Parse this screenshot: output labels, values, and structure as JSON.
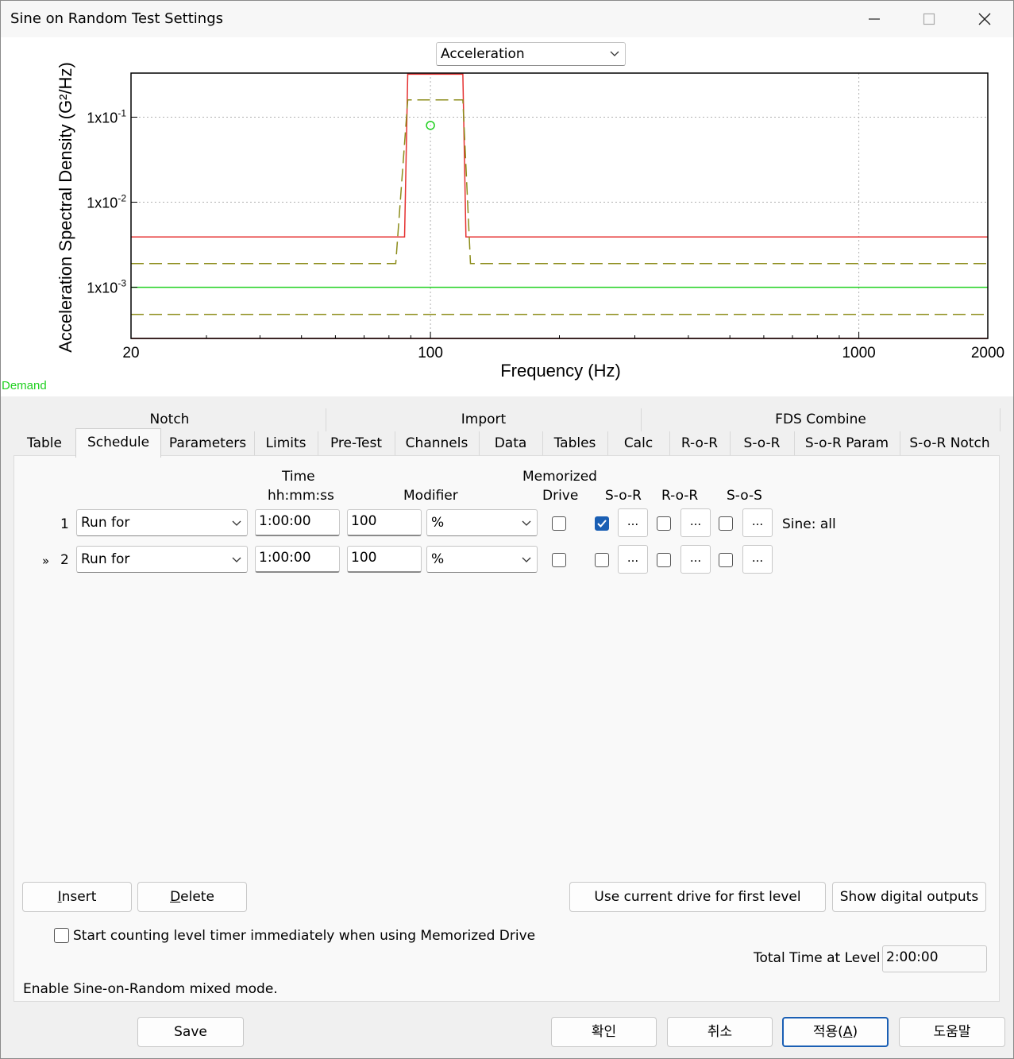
{
  "window": {
    "title": "Sine on Random Test Settings",
    "controls": [
      "minimize",
      "maximize",
      "close"
    ]
  },
  "chart_selector": {
    "value": "Acceleration"
  },
  "chart_data": {
    "type": "line",
    "ylabel": "Acceleration Spectral Density (G²/Hz)",
    "xlabel": "Frequency (Hz)",
    "x_scale": "log",
    "y_scale": "log",
    "xlim": [
      20,
      2000
    ],
    "ylim": [
      0.00025,
      0.33
    ],
    "x_ticks": [
      "20",
      "100",
      "1000",
      "2000"
    ],
    "y_ticks": [
      {
        "base": "1x10",
        "exp": "-1"
      },
      {
        "base": "1x10",
        "exp": "-2"
      },
      {
        "base": "1x10",
        "exp": "-3"
      }
    ],
    "grid": true,
    "series": [
      {
        "style": "red-solid",
        "color": "#e53030",
        "dash": false,
        "points": [
          [
            20,
            0.0039
          ],
          [
            85,
            0.0039
          ],
          [
            87,
            0.0039
          ],
          [
            88.5,
            0.32
          ],
          [
            119,
            0.32
          ],
          [
            121,
            0.0039
          ],
          [
            124,
            0.0039
          ],
          [
            2000,
            0.0039
          ]
        ]
      },
      {
        "style": "olive-dashed",
        "color": "#8c8c1a",
        "dash": true,
        "points": [
          [
            20,
            0.0019
          ],
          [
            83,
            0.0019
          ],
          [
            88.5,
            0.16
          ],
          [
            119,
            0.16
          ],
          [
            124,
            0.0019
          ],
          [
            2000,
            0.0019
          ]
        ]
      },
      {
        "style": "green-solid",
        "color": "#20d020",
        "dash": false,
        "points": [
          [
            20,
            0.001
          ],
          [
            2000,
            0.001
          ]
        ]
      },
      {
        "style": "olive-dashed-low",
        "color": "#8c8c1a",
        "dash": true,
        "points": [
          [
            20,
            0.00048
          ],
          [
            2000,
            0.00048
          ]
        ]
      },
      {
        "style": "red-solid-low",
        "color": "#e53030",
        "dash": false,
        "points": [
          [
            20,
            0.00025
          ],
          [
            2000,
            0.00025
          ]
        ]
      }
    ],
    "markers": [
      {
        "x": 100,
        "y": 0.08,
        "color": "#20d020",
        "shape": "circle"
      }
    ],
    "annotation": "Demand"
  },
  "tab_groups": [
    "Notch",
    "Import",
    "FDS Combine"
  ],
  "tabs": [
    "Table",
    "Schedule",
    "Parameters",
    "Limits",
    "Pre-Test",
    "Channels",
    "Data",
    "Tables",
    "Calc",
    "R-o-R",
    "S-o-R",
    "S-o-R Param",
    "S-o-R Notch"
  ],
  "active_tab": "Schedule",
  "columns": {
    "time": "Time",
    "time_format": "hh:mm:ss",
    "modifier": "Modifier",
    "memorized": "Memorized",
    "drive": "Drive",
    "sor": "S-o-R",
    "ror": "R-o-R",
    "sos": "S-o-S"
  },
  "rows": [
    {
      "marker": "",
      "index": "1",
      "action": "Run for",
      "time": "1:00:00",
      "value": "100",
      "modifier": "%",
      "drive": false,
      "sor": true,
      "ror": false,
      "sos": false,
      "note": "Sine: all"
    },
    {
      "marker": "»",
      "index": "2",
      "action": "Run for",
      "time": "1:00:00",
      "value": "100",
      "modifier": "%",
      "drive": false,
      "sor": false,
      "ror": false,
      "sos": false,
      "note": ""
    }
  ],
  "dots_label": "...",
  "buttons": {
    "insert": {
      "pre": "",
      "key": "I",
      "post": "nsert"
    },
    "delete": {
      "pre": "",
      "key": "D",
      "post": "elete"
    },
    "use_current_drive": "Use current drive for first level",
    "show_digital_outputs": "Show digital outputs"
  },
  "start_timer_checkbox": {
    "label": "Start counting level timer immediately when using Memorized Drive",
    "checked": false
  },
  "total_time": {
    "label": "Total Time at Level",
    "value": "2:00:00"
  },
  "status_text": "Enable Sine-on-Random mixed mode.",
  "footer": {
    "save": "Save",
    "ok": "확인",
    "cancel": "취소",
    "apply": {
      "pre": "적용(",
      "key": "A",
      "post": ")"
    },
    "help": "도움말"
  }
}
